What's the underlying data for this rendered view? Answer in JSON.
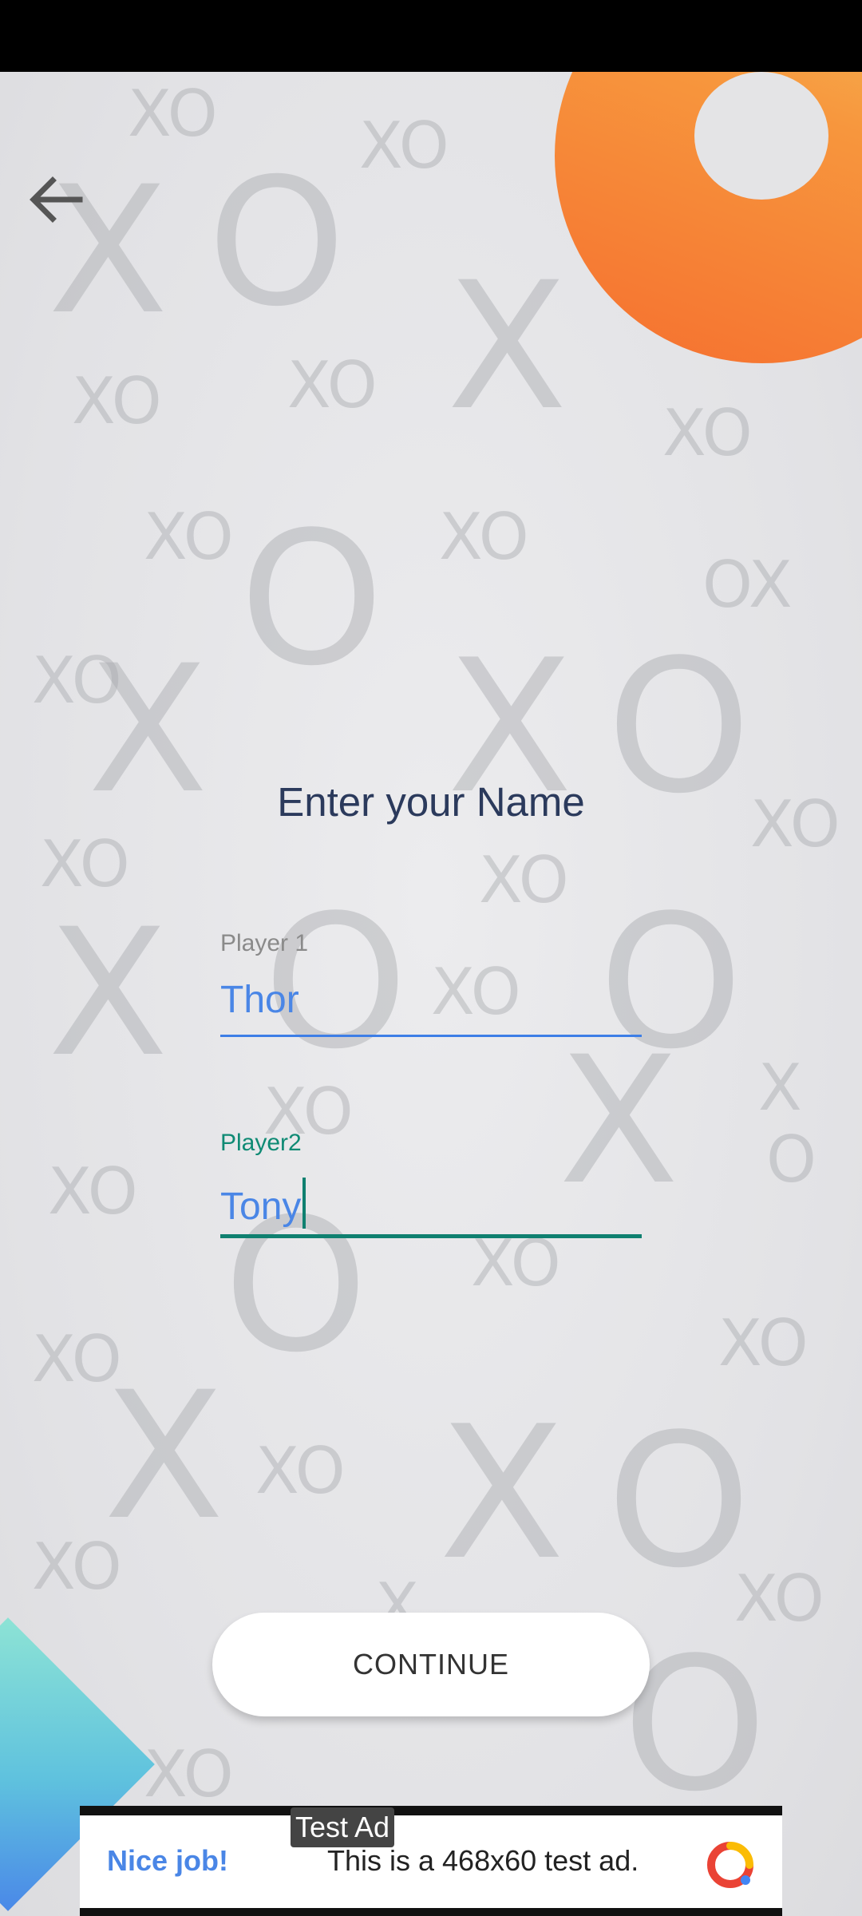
{
  "screen": {
    "title": "Enter your Name"
  },
  "player1": {
    "label": "Player 1",
    "value": "Thor"
  },
  "player2": {
    "label": "Player2",
    "value": "Tony"
  },
  "actions": {
    "continue_label": "CONTINUE"
  },
  "ad": {
    "tag": "Test Ad",
    "headline": "Nice job!",
    "body": "This is a 468x60 test ad."
  },
  "colors": {
    "title": "#2b3a5c",
    "input_text": "#4a86e6",
    "focus": "#0f8070",
    "accent_orange": "#f56f2f",
    "accent_teal": "#5fc2de"
  },
  "icons": {
    "back": "arrow-left",
    "ad_logo": "admob-logo"
  }
}
